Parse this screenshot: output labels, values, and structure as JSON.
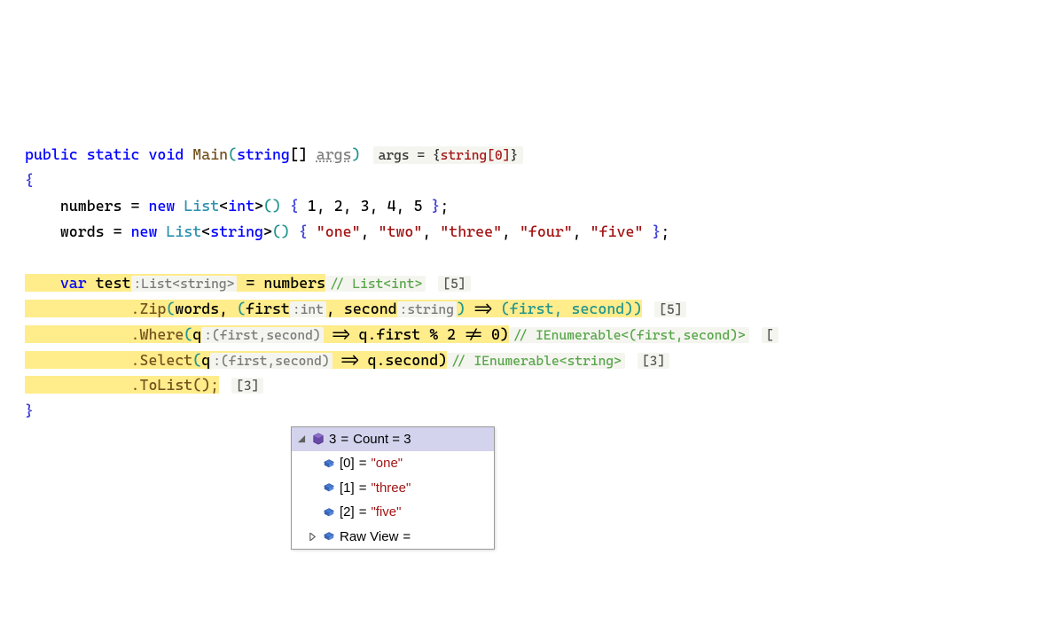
{
  "sig": {
    "kw_public": "public",
    "kw_static": "static",
    "kw_void": "void",
    "method": "Main",
    "type_string": "string",
    "param_args": "args",
    "debug_label": "args = {",
    "debug_value": "string[0]",
    "debug_close": "}"
  },
  "line_numbers": {
    "var": "numbers",
    "eq": "=",
    "kw_new": "new",
    "type_list": "List",
    "type_int": "int",
    "vals": [
      "1",
      "2",
      "3",
      "4",
      "5"
    ]
  },
  "line_words": {
    "var": "words",
    "eq": "=",
    "kw_new": "new",
    "type_list": "List",
    "type_string": "string",
    "vals": [
      "\"one\"",
      "\"two\"",
      "\"three\"",
      "\"four\"",
      "\"five\""
    ]
  },
  "chain": {
    "kw_var": "var",
    "var": "test",
    "hint_test": ":List<string>",
    "eq": "=",
    "src": "numbers",
    "src_type": "// List<int>",
    "src_count": "[5]",
    "zip": {
      "name": ".Zip",
      "arg1": "words",
      "p1": "first",
      "h1": ":int",
      "p2": "second",
      "h2": ":string",
      "body": "(first, second))",
      "count": "[5]"
    },
    "where": {
      "name": ".Where",
      "p": "q",
      "hp": ":(first,second)",
      "body": "q.first % 2 != 0)",
      "type_comment": "// IEnumerable<(first,second)>",
      "count": "["
    },
    "select": {
      "name": ".Select",
      "p": "q",
      "hp": ":(first,second)",
      "body": "q.second)",
      "type_comment": "// IEnumerable<string>",
      "count": "[3]"
    },
    "tolist": {
      "name": ".ToList();",
      "count": "[3]"
    }
  },
  "popup": {
    "header_key": "3",
    "header_label": "Count = 3",
    "rows": [
      {
        "key": "[0]",
        "val": "\"one\""
      },
      {
        "key": "[1]",
        "val": "\"three\""
      },
      {
        "key": "[2]",
        "val": "\"five\""
      }
    ],
    "raw": "Raw View"
  }
}
